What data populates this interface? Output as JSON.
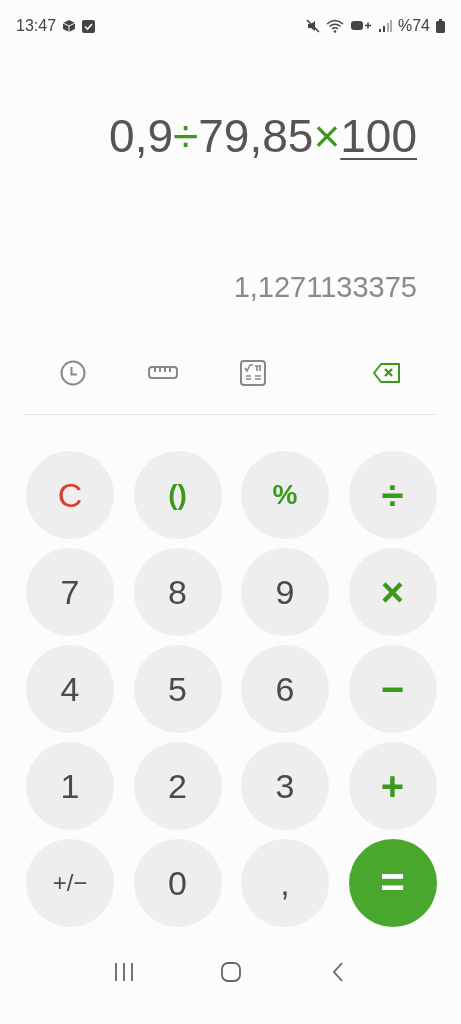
{
  "status_bar": {
    "time": "13:47",
    "battery": "%74"
  },
  "expression": [
    {
      "kind": "number",
      "text": "0,9",
      "editing": false
    },
    {
      "kind": "operator",
      "text": "÷",
      "editing": false
    },
    {
      "kind": "number",
      "text": "79,85",
      "editing": false
    },
    {
      "kind": "operator",
      "text": "×",
      "editing": false
    },
    {
      "kind": "number",
      "text": "100",
      "editing": true
    }
  ],
  "result": "1,1271133375",
  "keys": [
    [
      {
        "label": "C",
        "kind": "clear"
      },
      {
        "label": "()",
        "kind": "function"
      },
      {
        "label": "%",
        "kind": "function"
      },
      {
        "label": "÷",
        "kind": "operator"
      }
    ],
    [
      {
        "label": "7",
        "kind": "digit"
      },
      {
        "label": "8",
        "kind": "digit"
      },
      {
        "label": "9",
        "kind": "digit"
      },
      {
        "label": "×",
        "kind": "operator"
      }
    ],
    [
      {
        "label": "4",
        "kind": "digit"
      },
      {
        "label": "5",
        "kind": "digit"
      },
      {
        "label": "6",
        "kind": "digit"
      },
      {
        "label": "−",
        "kind": "operator"
      }
    ],
    [
      {
        "label": "1",
        "kind": "digit"
      },
      {
        "label": "2",
        "kind": "digit"
      },
      {
        "label": "3",
        "kind": "digit"
      },
      {
        "label": "+",
        "kind": "operator"
      }
    ],
    [
      {
        "label": "+/−",
        "kind": "digit"
      },
      {
        "label": "0",
        "kind": "digit"
      },
      {
        "label": ",",
        "kind": "digit"
      },
      {
        "label": "=",
        "kind": "equals"
      }
    ]
  ]
}
